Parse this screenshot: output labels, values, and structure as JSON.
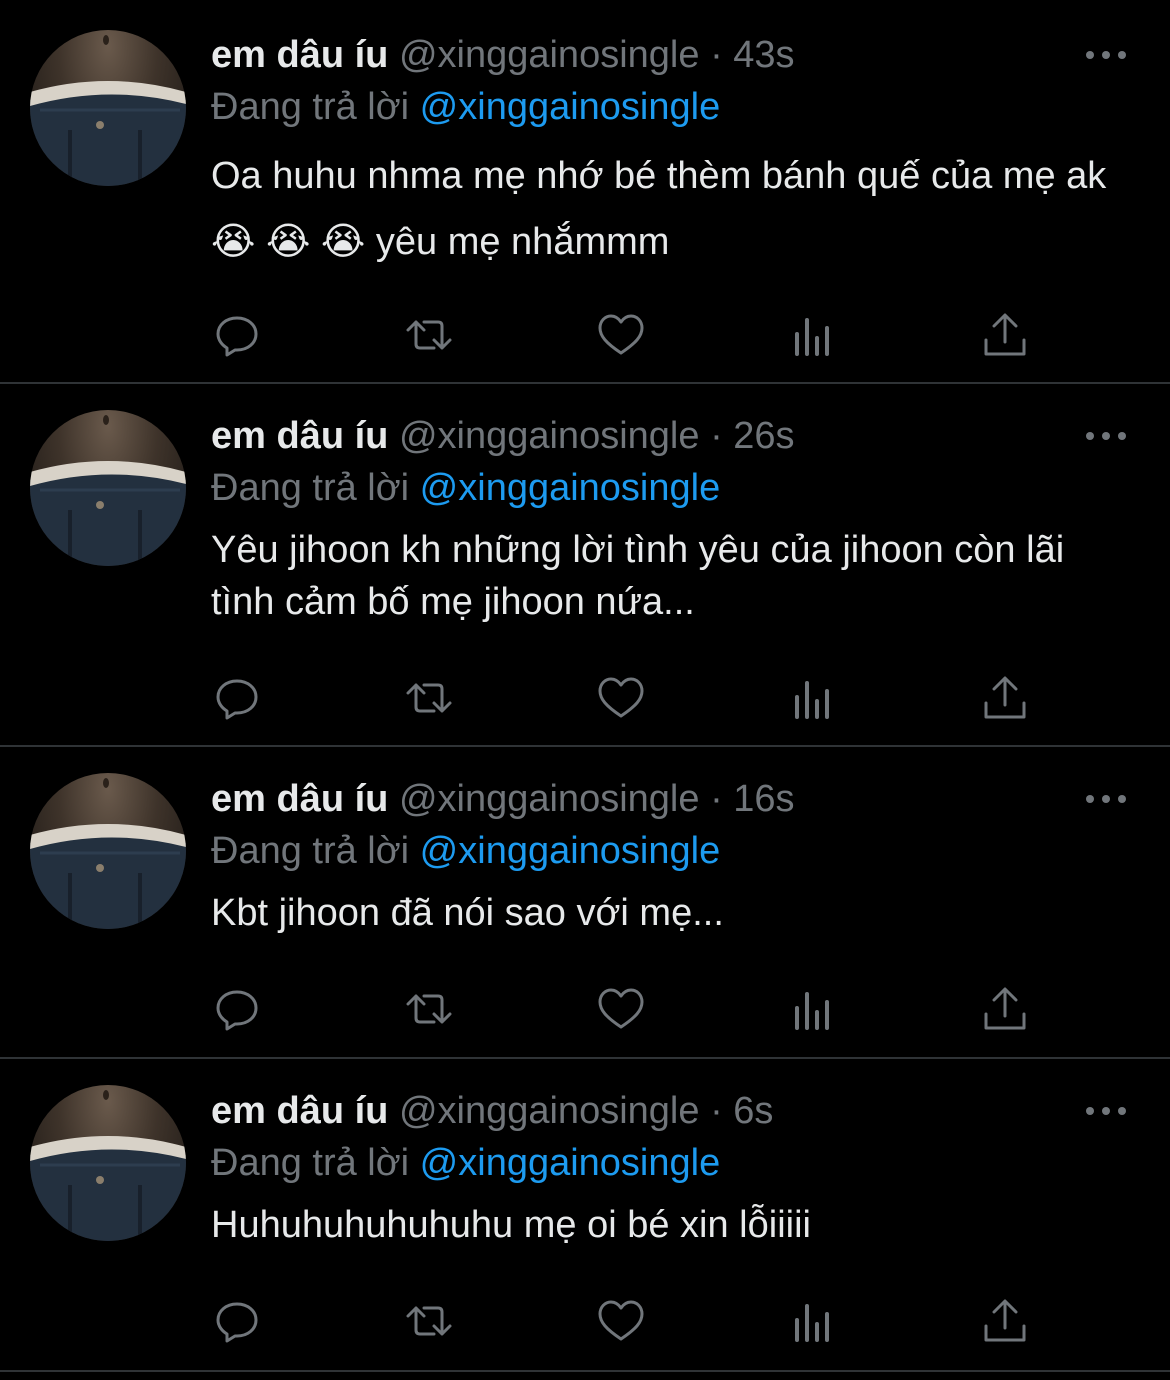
{
  "tweets": [
    {
      "name": "em dâu íu",
      "handle": "@xinggainosingle",
      "dot": "·",
      "time": "43s",
      "reply_prefix": "Đang trả lời",
      "reply_to": "@xinggainosingle",
      "text": "Oa huhu nhma mẹ nhớ bé thèm bánh quế của mẹ ak😭 😭 😭 yêu mẹ nhắmmm"
    },
    {
      "name": "em dâu íu",
      "handle": "@xinggainosingle",
      "dot": "·",
      "time": "26s",
      "reply_prefix": "Đang trả lời",
      "reply_to": "@xinggainosingle",
      "text": "Yêu jihoon kh những lời tình yêu của jihoon còn lãi tình cảm bố mẹ jihoon nứa..."
    },
    {
      "name": "em dâu íu",
      "handle": "@xinggainosingle",
      "dot": "·",
      "time": "16s",
      "reply_prefix": "Đang trả lời",
      "reply_to": "@xinggainosingle",
      "text": "Kbt jihoon đã nói sao với mẹ..."
    },
    {
      "name": "em dâu íu",
      "handle": "@xinggainosingle",
      "dot": "·",
      "time": "6s",
      "reply_prefix": "Đang trả lời",
      "reply_to": "@xinggainosingle",
      "text": "Huhuhuhuhuhuhu mẹ oi bé xin lỗiiiii"
    }
  ],
  "icons": {
    "more": "more-horizontal-icon",
    "reply": "reply-icon",
    "retweet": "retweet-icon",
    "like": "heart-icon",
    "views": "views-chart-icon",
    "share": "share-icon"
  },
  "colors": {
    "background": "#000000",
    "text": "#e7e9ea",
    "muted": "#71767b",
    "link": "#1d9bf0",
    "divider": "#2f3336"
  }
}
